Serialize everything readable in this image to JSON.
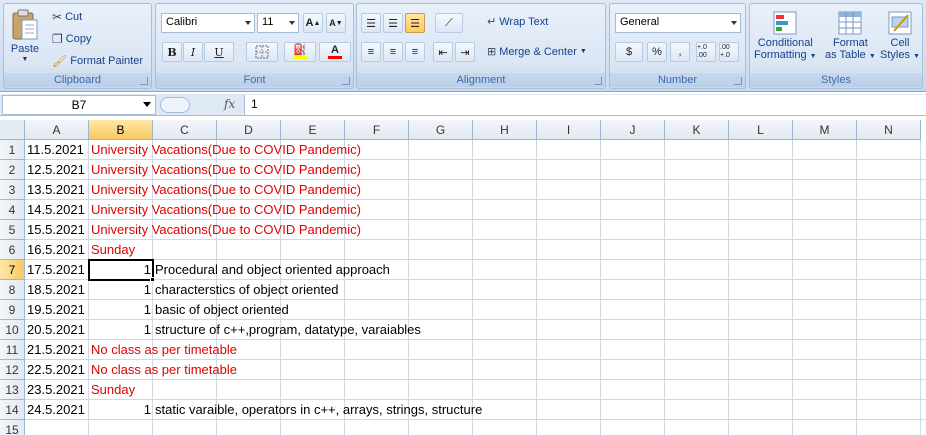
{
  "ribbon": {
    "clipboard": {
      "paste": "Paste",
      "cut": "Cut",
      "copy": "Copy",
      "format_painter": "Format Painter",
      "label": "Clipboard"
    },
    "font": {
      "name": "Calibri",
      "size": "11",
      "bold": "B",
      "italic": "I",
      "underline": "U",
      "grow": "A",
      "shrink": "A",
      "font_color": "A",
      "label": "Font",
      "fill_color": "#ffff00",
      "text_color": "#ff0000"
    },
    "alignment": {
      "wrap_text": "Wrap Text",
      "merge_center": "Merge & Center",
      "label": "Alignment"
    },
    "number": {
      "format": "General",
      "currency": "$",
      "percent": "%",
      "comma": ",",
      "inc_decimal": "+.0 .00",
      "dec_decimal": ".00 +.0",
      "label": "Number"
    },
    "styles": {
      "conditional": "Conditional",
      "conditional2": "Formatting",
      "format_table": "Format",
      "format_table2": "as Table",
      "cell_styles": "Cell",
      "cell_styles2": "Styles",
      "label": "Styles"
    }
  },
  "formula_bar": {
    "name_box": "B7",
    "fx": "fx",
    "value": "1"
  },
  "columns": [
    "A",
    "B",
    "C",
    "D",
    "E",
    "F",
    "G",
    "H",
    "I",
    "J",
    "K",
    "L",
    "M",
    "N"
  ],
  "rows": [
    "1",
    "2",
    "3",
    "4",
    "5",
    "6",
    "7",
    "8",
    "9",
    "10",
    "11",
    "12",
    "13",
    "14",
    "15"
  ],
  "cells": [
    {
      "a": "11.5.2021",
      "b": "University Vacations(Due to COVID Pandemic)",
      "b_red": true
    },
    {
      "a": "12.5.2021",
      "b": "University Vacations(Due to COVID Pandemic)",
      "b_red": true
    },
    {
      "a": "13.5.2021",
      "b": "University Vacations(Due to COVID Pandemic)",
      "b_red": true
    },
    {
      "a": "14.5.2021",
      "b": "University Vacations(Due to COVID Pandemic)",
      "b_red": true
    },
    {
      "a": "15.5.2021",
      "b": "University Vacations(Due to COVID Pandemic)",
      "b_red": true
    },
    {
      "a": "16.5.2021",
      "b": "Sunday",
      "b_red": true
    },
    {
      "a": "17.5.2021",
      "b_num": "1",
      "c": "Procedural and object oriented approach"
    },
    {
      "a": "18.5.2021",
      "b_num": "1",
      "c": "characterstics of object oriented"
    },
    {
      "a": "19.5.2021",
      "b_num": "1",
      "c": "basic of object oriented"
    },
    {
      "a": "20.5.2021",
      "b_num": "1",
      "c": "structure of c++,program, datatype, varaiables"
    },
    {
      "a": "21.5.2021",
      "b": "No class as per timetable",
      "b_red": true
    },
    {
      "a": "22.5.2021",
      "b": "No class as per timetable",
      "b_red": true
    },
    {
      "a": "23.5.2021",
      "b": "Sunday",
      "b_red": true
    },
    {
      "a": "24.5.2021",
      "b_num": "1",
      "c": "static varaible, operators in c++, arrays, strings, structure"
    },
    {
      "a": ""
    }
  ],
  "selected_cell": "B7",
  "colors": {
    "accent": "#e00000",
    "selection_header": "#f9c863"
  }
}
